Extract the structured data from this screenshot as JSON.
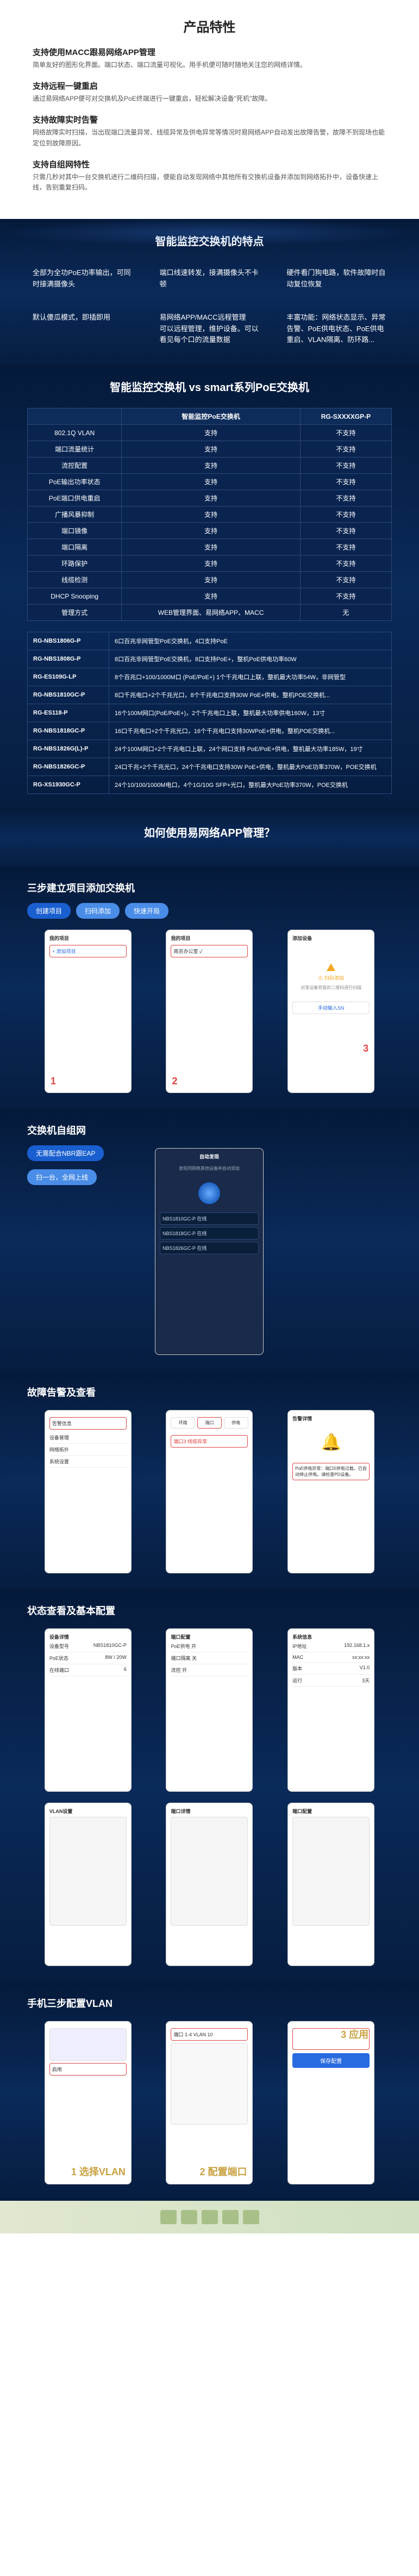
{
  "features": {
    "title": "产品特性",
    "items": [
      {
        "title": "支持使用MACC跟易网络APP管理",
        "desc": "简单友好的图形化界面。端口状态、端口流量可视化。用手机便可随时随地关注您的网络详情。"
      },
      {
        "title": "支持远程一键重启",
        "desc": "通过易网络APP便可对交换机及PoE终端进行一键重启，轻松解决设备\"死机\"故障。"
      },
      {
        "title": "支持故障实时告警",
        "desc": "网络故障实时扫描，当出现端口流量异常、线缆异常及供电异常等情况时易网络APP自动发出故障告警，故障不到现场也能定位到故障原因。"
      },
      {
        "title": "支持自组网特性",
        "desc": "只需几秒对其中一台交换机进行二维码扫描，便能自动发现网络中其他所有交换机设备并添加到网络拓扑中，设备快速上线，告别重复扫码。"
      }
    ]
  },
  "points": {
    "title": "智能监控交换机的特点",
    "cells": [
      "全部为全功PoE功率输出，可同时接满摄像头",
      "端口线速转发，接满摄像头不卡顿",
      "硬件看门狗电路，软件故障时自动复位恢复",
      "默认傻瓜模式，即插即用",
      "易网络APP/MACC远程管理\n可以远程管理，维护设备。可以看见每个口的流量数据",
      "丰富功能：网络状态显示、异常告警、PoE供电状态、PoE供电重启、VLAN隔离、防环路..."
    ]
  },
  "compare": {
    "title": "智能监控交换机 vs smart系列PoE交换机",
    "headers": [
      "",
      "智能监控PoE交换机",
      "RG-SXXXXGP-P"
    ],
    "rows": [
      [
        "802.1Q VLAN",
        "支持",
        "不支持"
      ],
      [
        "端口流量统计",
        "支持",
        "不支持"
      ],
      [
        "流控配置",
        "支持",
        "不支持"
      ],
      [
        "PoE输出功率状态",
        "支持",
        "不支持"
      ],
      [
        "PoE端口供电重启",
        "支持",
        "不支持"
      ],
      [
        "广播风暴抑制",
        "支持",
        "不支持"
      ],
      [
        "端口镜像",
        "支持",
        "不支持"
      ],
      [
        "端口隔离",
        "支持",
        "不支持"
      ],
      [
        "环路保护",
        "支持",
        "不支持"
      ],
      [
        "线缆检测",
        "支持",
        "不支持"
      ],
      [
        "DHCP Snooping",
        "支持",
        "不支持"
      ],
      [
        "管理方式",
        "WEB管理界面、易网络APP、MACC",
        "无"
      ]
    ]
  },
  "specs": [
    [
      "RG-NBS1806G-P",
      "6口百兆非网管型PoE交换机，4口支持PoE"
    ],
    [
      "RG-NBS1808G-P",
      "8口百兆非网管型PoE交换机，8口支持PoE+，整机PoE供电功率60W"
    ],
    [
      "RG-ES109G-LP",
      "8个百兆口+100/1000M口 (PoE/PoE+) 1个千兆电口上联，整机最大功率54W，非网管型"
    ],
    [
      "RG-NBS1810GC-P",
      "8口千兆电口+2个千兆光口，8个千兆电口支持30W PoE+供电，整机POE交换机..."
    ],
    [
      "RG-ES118-P",
      "16个100M网口(PoE/PoE+)，2个千兆电口上联，整机最大功率供电160W，13寸"
    ],
    [
      "RG-NBS1818GC-P",
      "16口千兆电口+2个千兆光口，16个千兆电口支持30WPoE+供电，整机POE交换机..."
    ],
    [
      "RG-NBS1826G(L)-P",
      "24个100M网口+2个千兆电口上联，24个网口支持 PoE/PoE+供电，整机最大功率185W，19寸"
    ],
    [
      "RG-NBS1826GC-P",
      "24口千兆+2个千兆光口，24个千兆电口支持30W PoE+供电，整机最大PoE功率370W，POE交换机"
    ],
    [
      "RG-XS1930GC-P",
      "24个10/100/1000M电口，4个1G/10G SFP+光口，整机最大PoE功率370W，POE交换机"
    ]
  ],
  "howto": {
    "title": "如何使用易网络APP管理？",
    "step1": {
      "title": "三步建立项目添加交换机",
      "pills": [
        "创建项目",
        "扫码添加",
        "快速开局"
      ],
      "phone1": {
        "header": "我的项目",
        "add": "+ 添加项目",
        "n1": "1"
      },
      "phone2": {
        "header": "我的项目",
        "proj": "南京办公室 ✓",
        "n2": "2"
      },
      "phone3": {
        "header": "添加设备",
        "hint": "⚠ 扫码添加",
        "desc": "对准设备背面的二维码进行扫描",
        "btn": "手动输入SN",
        "n3": "3"
      }
    },
    "selfnet": {
      "title": "交换机自组网",
      "pill1": "无需配合NBR跟EAP",
      "pill2": "扫一台，全网上线",
      "phone_top": "自动发现",
      "phone_desc": "发现同网络其他设备并自动添加",
      "list": [
        "NBS1810GC-P  在线",
        "NBS1818GC-P  在线",
        "NBS1826GC-P  在线"
      ]
    },
    "alarm": {
      "title": "故障告警及查看",
      "phone1_items": [
        "告警信息",
        "设备管理",
        "网络拓扑",
        "系统设置"
      ],
      "phone2_tabs": [
        "环路",
        "端口",
        "供电"
      ],
      "phone2_msg": "端口3 线缆异常",
      "phone3_title": "告警详情",
      "phone3_body": "PoE供电异常：端口5供电过载，已自动停止供电。请检查PD设备。"
    },
    "status": {
      "title": "状态查看及基本配置",
      "phone1_title": "设备详情",
      "phone1_rows": [
        [
          "设备型号",
          "NBS1810GC-P"
        ],
        [
          "PoE状态",
          "8W / 20W"
        ],
        [
          "在线端口",
          "6"
        ]
      ],
      "phone2_title": "端口配置",
      "phone2_sw": [
        "PoE供电 开",
        "端口隔离 关",
        "流控 开"
      ],
      "phone3_title": "系统信息",
      "phone3_rows": [
        [
          "IP地址",
          "192.168.1.x"
        ],
        [
          "MAC",
          "xx:xx:xx"
        ],
        [
          "版本",
          "V1.0"
        ],
        [
          "运行",
          "3天"
        ]
      ],
      "phone4_title": "VLAN设置",
      "phone5_title": "端口详情",
      "phone6_title": "端口配置"
    },
    "vlan": {
      "title": "手机三步配置VLAN",
      "p1_label": "1 选择VLAN",
      "p1_btn": "启用",
      "p2_label": "2 配置端口",
      "p2_sel": "端口 1-4  VLAN 10",
      "p3_label": "3 应用",
      "p3_btn": "保存配置"
    }
  }
}
